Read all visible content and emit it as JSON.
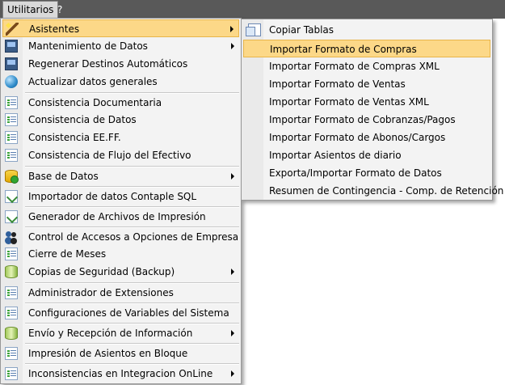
{
  "menubar": {
    "items": [
      {
        "label": "Utilitarios"
      },
      {
        "label": "?"
      }
    ]
  },
  "main_menu": {
    "items": [
      {
        "label": "Asistentes",
        "icon": "wand-icon",
        "submenu": true
      },
      {
        "label": "Mantenimiento de Datos",
        "icon": "screen-icon",
        "submenu": true
      },
      {
        "label": "Regenerar Destinos Automáticos",
        "icon": "screen-icon",
        "submenu": false
      },
      {
        "label": "Actualizar datos generales",
        "icon": "globe-icon",
        "submenu": false
      },
      {
        "label": "Consistencia Documentaria",
        "icon": "list-icon",
        "submenu": false
      },
      {
        "label": "Consistencia de Datos",
        "icon": "list-icon",
        "submenu": false
      },
      {
        "label": "Consistencia EE.FF.",
        "icon": "list-icon",
        "submenu": false
      },
      {
        "label": "Consistencia de Flujo del Efectivo",
        "icon": "list-icon",
        "submenu": false
      },
      {
        "label": "Base de Datos",
        "icon": "database-icon",
        "submenu": true
      },
      {
        "label": "Importador de datos Contaple SQL",
        "icon": "import-icon",
        "submenu": false
      },
      {
        "label": "Generador de Archivos de Impresión",
        "icon": "import-icon",
        "submenu": false
      },
      {
        "label": "Control de Accesos a Opciones de Empresa",
        "icon": "users-icon",
        "submenu": false
      },
      {
        "label": "Cierre de Meses",
        "icon": "list-icon",
        "submenu": false
      },
      {
        "label": "Copias de Seguridad (Backup)",
        "icon": "cylinder-icon",
        "submenu": true
      },
      {
        "label": "Administrador de Extensiones",
        "icon": "list-icon",
        "submenu": false
      },
      {
        "label": "Configuraciones de Variables del Sistema",
        "icon": "list-icon",
        "submenu": false
      },
      {
        "label": "Envío y Recepción de Información",
        "icon": "cylinder-icon",
        "submenu": true
      },
      {
        "label": "Impresión de Asientos en Bloque",
        "icon": "list-icon",
        "submenu": false
      },
      {
        "label": "Inconsistencias en Integracion OnLine",
        "icon": "list-icon",
        "submenu": true
      }
    ]
  },
  "sub_menu": {
    "items": [
      {
        "label": "Copiar Tablas",
        "icon": "copy-icon"
      },
      {
        "label": "Importar Formato de Compras"
      },
      {
        "label": "Importar Formato de Compras XML"
      },
      {
        "label": "Importar Formato de Ventas"
      },
      {
        "label": "Importar Formato de Ventas XML"
      },
      {
        "label": "Importar Formato de Cobranzas/Pagos"
      },
      {
        "label": "Importar Formato de Abonos/Cargos"
      },
      {
        "label": "Importar Asientos de diario"
      },
      {
        "label": "Exporta/Importar Formato de Datos"
      },
      {
        "label": "Resumen de Contingencia - Comp. de Retención"
      }
    ]
  },
  "colors": {
    "menubar_bg": "#595959",
    "menu_bg": "#f3f3f3",
    "highlight_bg": "#fcd888",
    "highlight_border": "#e8b54a"
  }
}
